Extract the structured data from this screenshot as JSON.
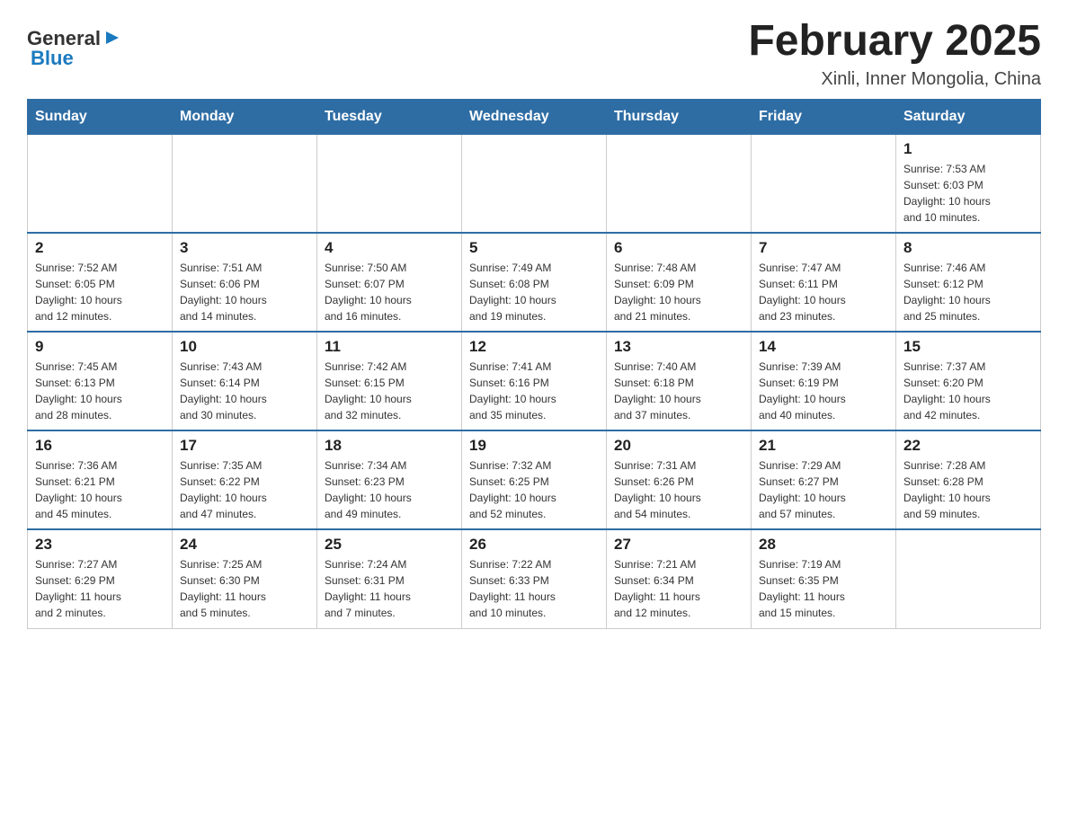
{
  "header": {
    "logo_text_general": "General",
    "logo_text_blue": "Blue",
    "month_title": "February 2025",
    "location": "Xinli, Inner Mongolia, China"
  },
  "days_of_week": [
    "Sunday",
    "Monday",
    "Tuesday",
    "Wednesday",
    "Thursday",
    "Friday",
    "Saturday"
  ],
  "weeks": [
    [
      {
        "day": "",
        "info": ""
      },
      {
        "day": "",
        "info": ""
      },
      {
        "day": "",
        "info": ""
      },
      {
        "day": "",
        "info": ""
      },
      {
        "day": "",
        "info": ""
      },
      {
        "day": "",
        "info": ""
      },
      {
        "day": "1",
        "info": "Sunrise: 7:53 AM\nSunset: 6:03 PM\nDaylight: 10 hours\nand 10 minutes."
      }
    ],
    [
      {
        "day": "2",
        "info": "Sunrise: 7:52 AM\nSunset: 6:05 PM\nDaylight: 10 hours\nand 12 minutes."
      },
      {
        "day": "3",
        "info": "Sunrise: 7:51 AM\nSunset: 6:06 PM\nDaylight: 10 hours\nand 14 minutes."
      },
      {
        "day": "4",
        "info": "Sunrise: 7:50 AM\nSunset: 6:07 PM\nDaylight: 10 hours\nand 16 minutes."
      },
      {
        "day": "5",
        "info": "Sunrise: 7:49 AM\nSunset: 6:08 PM\nDaylight: 10 hours\nand 19 minutes."
      },
      {
        "day": "6",
        "info": "Sunrise: 7:48 AM\nSunset: 6:09 PM\nDaylight: 10 hours\nand 21 minutes."
      },
      {
        "day": "7",
        "info": "Sunrise: 7:47 AM\nSunset: 6:11 PM\nDaylight: 10 hours\nand 23 minutes."
      },
      {
        "day": "8",
        "info": "Sunrise: 7:46 AM\nSunset: 6:12 PM\nDaylight: 10 hours\nand 25 minutes."
      }
    ],
    [
      {
        "day": "9",
        "info": "Sunrise: 7:45 AM\nSunset: 6:13 PM\nDaylight: 10 hours\nand 28 minutes."
      },
      {
        "day": "10",
        "info": "Sunrise: 7:43 AM\nSunset: 6:14 PM\nDaylight: 10 hours\nand 30 minutes."
      },
      {
        "day": "11",
        "info": "Sunrise: 7:42 AM\nSunset: 6:15 PM\nDaylight: 10 hours\nand 32 minutes."
      },
      {
        "day": "12",
        "info": "Sunrise: 7:41 AM\nSunset: 6:16 PM\nDaylight: 10 hours\nand 35 minutes."
      },
      {
        "day": "13",
        "info": "Sunrise: 7:40 AM\nSunset: 6:18 PM\nDaylight: 10 hours\nand 37 minutes."
      },
      {
        "day": "14",
        "info": "Sunrise: 7:39 AM\nSunset: 6:19 PM\nDaylight: 10 hours\nand 40 minutes."
      },
      {
        "day": "15",
        "info": "Sunrise: 7:37 AM\nSunset: 6:20 PM\nDaylight: 10 hours\nand 42 minutes."
      }
    ],
    [
      {
        "day": "16",
        "info": "Sunrise: 7:36 AM\nSunset: 6:21 PM\nDaylight: 10 hours\nand 45 minutes."
      },
      {
        "day": "17",
        "info": "Sunrise: 7:35 AM\nSunset: 6:22 PM\nDaylight: 10 hours\nand 47 minutes."
      },
      {
        "day": "18",
        "info": "Sunrise: 7:34 AM\nSunset: 6:23 PM\nDaylight: 10 hours\nand 49 minutes."
      },
      {
        "day": "19",
        "info": "Sunrise: 7:32 AM\nSunset: 6:25 PM\nDaylight: 10 hours\nand 52 minutes."
      },
      {
        "day": "20",
        "info": "Sunrise: 7:31 AM\nSunset: 6:26 PM\nDaylight: 10 hours\nand 54 minutes."
      },
      {
        "day": "21",
        "info": "Sunrise: 7:29 AM\nSunset: 6:27 PM\nDaylight: 10 hours\nand 57 minutes."
      },
      {
        "day": "22",
        "info": "Sunrise: 7:28 AM\nSunset: 6:28 PM\nDaylight: 10 hours\nand 59 minutes."
      }
    ],
    [
      {
        "day": "23",
        "info": "Sunrise: 7:27 AM\nSunset: 6:29 PM\nDaylight: 11 hours\nand 2 minutes."
      },
      {
        "day": "24",
        "info": "Sunrise: 7:25 AM\nSunset: 6:30 PM\nDaylight: 11 hours\nand 5 minutes."
      },
      {
        "day": "25",
        "info": "Sunrise: 7:24 AM\nSunset: 6:31 PM\nDaylight: 11 hours\nand 7 minutes."
      },
      {
        "day": "26",
        "info": "Sunrise: 7:22 AM\nSunset: 6:33 PM\nDaylight: 11 hours\nand 10 minutes."
      },
      {
        "day": "27",
        "info": "Sunrise: 7:21 AM\nSunset: 6:34 PM\nDaylight: 11 hours\nand 12 minutes."
      },
      {
        "day": "28",
        "info": "Sunrise: 7:19 AM\nSunset: 6:35 PM\nDaylight: 11 hours\nand 15 minutes."
      },
      {
        "day": "",
        "info": ""
      }
    ]
  ]
}
